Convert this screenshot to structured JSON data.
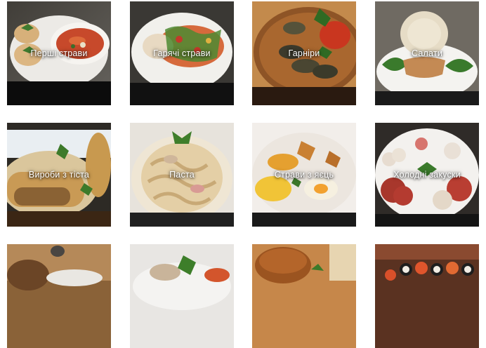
{
  "categories": [
    {
      "label": "Перші страви"
    },
    {
      "label": "Гарячі страви"
    },
    {
      "label": "Гарніри"
    },
    {
      "label": "Салати"
    },
    {
      "label": "Вироби з тіста"
    },
    {
      "label": "Паста"
    },
    {
      "label": "Страви з яєць"
    },
    {
      "label": "Холодні закуски"
    },
    {
      "label": ""
    },
    {
      "label": ""
    },
    {
      "label": ""
    },
    {
      "label": ""
    }
  ]
}
